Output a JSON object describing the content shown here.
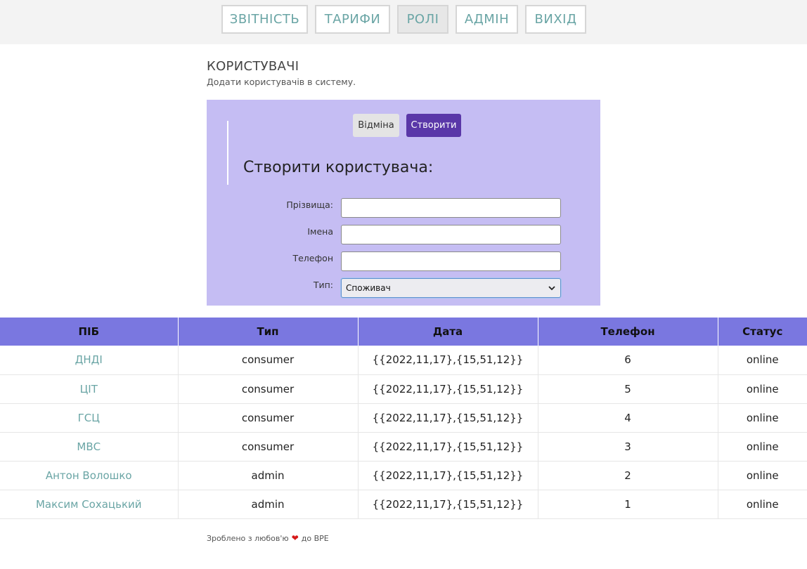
{
  "nav": {
    "items": [
      {
        "label": "ЗВІТНІСТЬ",
        "active": false
      },
      {
        "label": "ТАРИФИ",
        "active": false
      },
      {
        "label": "РОЛІ",
        "active": true
      },
      {
        "label": "АДМІН",
        "active": false
      },
      {
        "label": "ВИХІД",
        "active": false
      }
    ]
  },
  "section": {
    "title": "КОРИСТУВАЧІ",
    "subtitle": "Додати користувачів в систему."
  },
  "form": {
    "cancel_label": "Відміна",
    "create_label": "Створити",
    "heading": "Створити користувача:",
    "fields": {
      "surname": {
        "label": "Прізвища:",
        "value": ""
      },
      "names": {
        "label": "Імена",
        "value": ""
      },
      "phone": {
        "label": "Телефон",
        "value": ""
      },
      "type": {
        "label": "Тип:",
        "selected": "Споживач"
      }
    }
  },
  "table": {
    "headers": [
      "ПІБ",
      "Тип",
      "Дата",
      "Телефон",
      "Статус"
    ],
    "rows": [
      {
        "name": "ДНДІ",
        "type": "consumer",
        "date": "{{2022,11,17},{15,51,12}}",
        "phone": "6",
        "status": "online"
      },
      {
        "name": "ЦІТ",
        "type": "consumer",
        "date": "{{2022,11,17},{15,51,12}}",
        "phone": "5",
        "status": "online"
      },
      {
        "name": "ГСЦ",
        "type": "consumer",
        "date": "{{2022,11,17},{15,51,12}}",
        "phone": "4",
        "status": "online"
      },
      {
        "name": "МВС",
        "type": "consumer",
        "date": "{{2022,11,17},{15,51,12}}",
        "phone": "3",
        "status": "online"
      },
      {
        "name": "Антон Волошко",
        "type": "admin",
        "date": "{{2022,11,17},{15,51,12}}",
        "phone": "2",
        "status": "online"
      },
      {
        "name": "Максим Сохацький",
        "type": "admin",
        "date": "{{2022,11,17},{15,51,12}}",
        "phone": "1",
        "status": "online"
      }
    ]
  },
  "footer": {
    "prefix": "Зроблено з любов'ю",
    "suffix": "до ВРЕ",
    "heart_icon": "heart-icon",
    "heart_color": "#d61a1a"
  }
}
